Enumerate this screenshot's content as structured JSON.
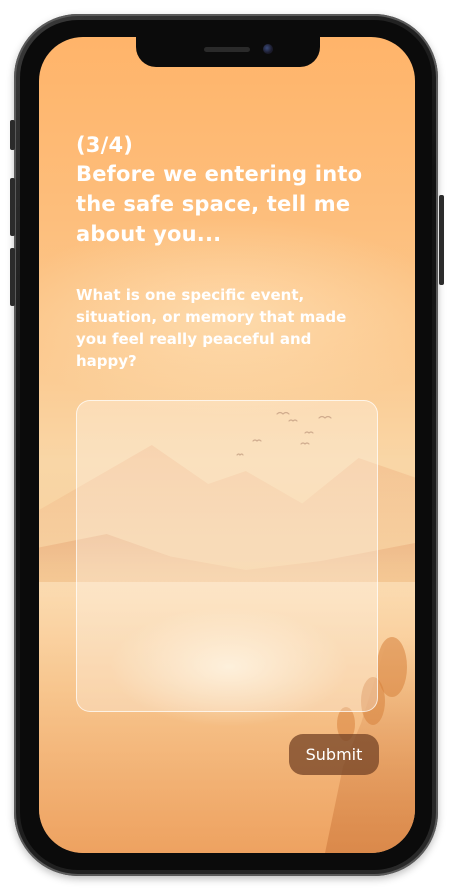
{
  "progress": {
    "step_label": "(3/4)",
    "current_step": 3,
    "total_steps": 4
  },
  "page": {
    "heading": "Before we entering into the safe space, tell me about you..."
  },
  "question": {
    "text": "What is one specific event, situation, or memory that made you feel really peaceful and happy?"
  },
  "answer": {
    "value": "",
    "placeholder": ""
  },
  "actions": {
    "submit_label": "Submit"
  },
  "colors": {
    "background_top": "#ffb46a",
    "background_bottom": "#eea663",
    "text": "#ffffff",
    "submit_button": "#784628",
    "device_frame": "#111111"
  },
  "icons": {
    "front_camera": "camera-icon",
    "speaker": "speaker-grille-icon"
  }
}
